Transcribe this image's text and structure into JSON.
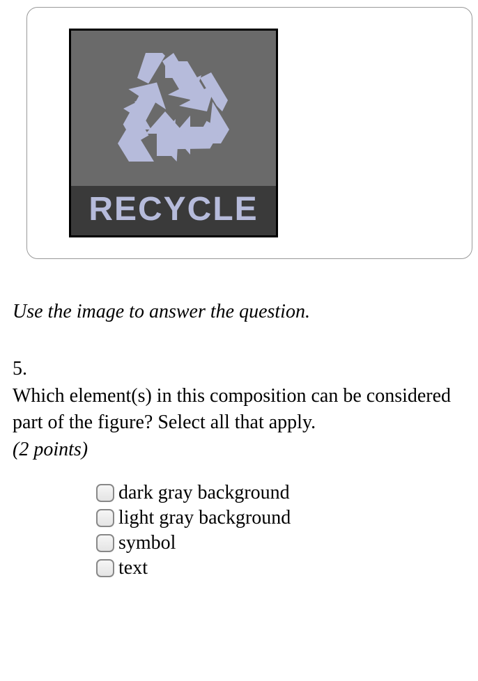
{
  "image": {
    "label": "RECYCLE"
  },
  "instruction": "Use the image to answer the question.",
  "question": {
    "number": "5.",
    "text": "Which element(s) in this composition can be considered part of the figure? Select all that apply.",
    "points": "(2 points)"
  },
  "options": [
    {
      "label": "dark gray background",
      "checked": false
    },
    {
      "label": "light gray background",
      "checked": false
    },
    {
      "label": "symbol",
      "checked": false
    },
    {
      "label": "text",
      "checked": false
    }
  ]
}
